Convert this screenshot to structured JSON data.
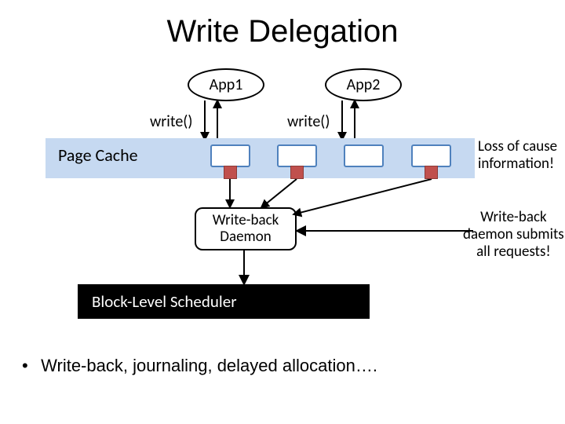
{
  "title": "Write Delegation",
  "app1_label": "App1",
  "app2_label": "App2",
  "write1_label": "write()",
  "write2_label": "write()",
  "pagecache_label": "Page Cache",
  "loss_note_line1": "Loss of cause",
  "loss_note_line2": "information!",
  "wbdaemon_line1": "Write-back",
  "wbdaemon_line2": "Daemon",
  "submit_note_line1": "Write-back",
  "submit_note_line2": "daemon submits",
  "submit_note_line3": "all requests!",
  "scheduler_label": "Block-Level Scheduler",
  "bullet_text": "Write-back, journaling, delayed allocation….",
  "colors": {
    "band": "#c6d9f1",
    "block_border": "#4f81bd",
    "dirty_fill": "#c0504d"
  }
}
